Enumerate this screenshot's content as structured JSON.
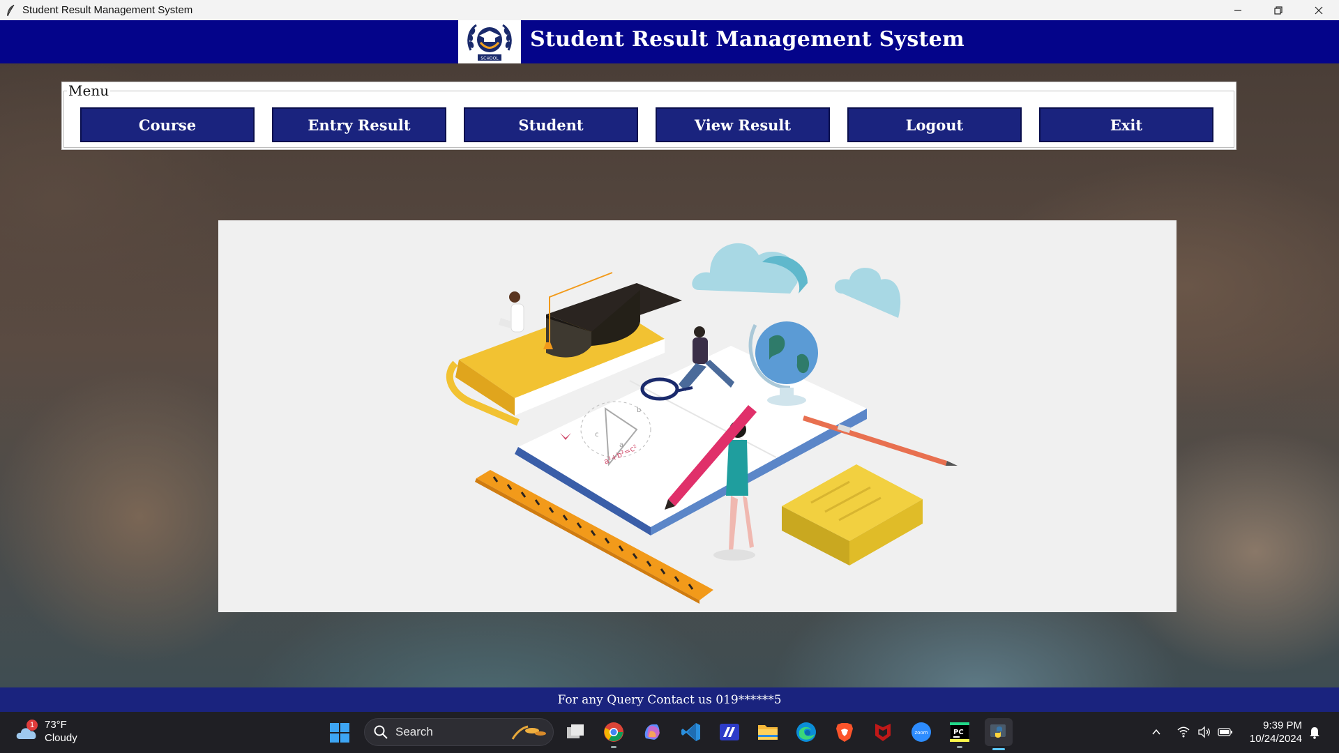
{
  "window": {
    "title": "Student Result Management System"
  },
  "header": {
    "title": "Student Result Management System",
    "logo_text": "SCHOOL",
    "background_color": "#04048a"
  },
  "menu": {
    "label": "Menu",
    "buttons": [
      {
        "label": "Course"
      },
      {
        "label": "Entry Result"
      },
      {
        "label": "Student"
      },
      {
        "label": "View Result"
      },
      {
        "label": "Logout"
      },
      {
        "label": "Exit"
      }
    ],
    "button_color": "#1a237e"
  },
  "illustration": {
    "math_text": "a²+b²=c²",
    "triangle_labels": [
      "a",
      "b",
      "c"
    ]
  },
  "footer": {
    "text": "For any Query Contact us 019******5"
  },
  "taskbar": {
    "weather": {
      "temperature": "73°F",
      "condition": "Cloudy",
      "badge": "1"
    },
    "search_label": "Search",
    "apps": [
      "file-manager-icon",
      "chrome-icon",
      "copilot-icon",
      "vscode-icon",
      "powerautomate-icon",
      "file-explorer-icon",
      "edge-icon",
      "brave-icon",
      "mcafee-icon",
      "zoom-icon",
      "pycharm-icon",
      "python-icon"
    ],
    "zoom_label": "zoom",
    "pycharm_label": "PC",
    "clock": {
      "time": "9:39 PM",
      "date": "10/24/2024"
    }
  }
}
